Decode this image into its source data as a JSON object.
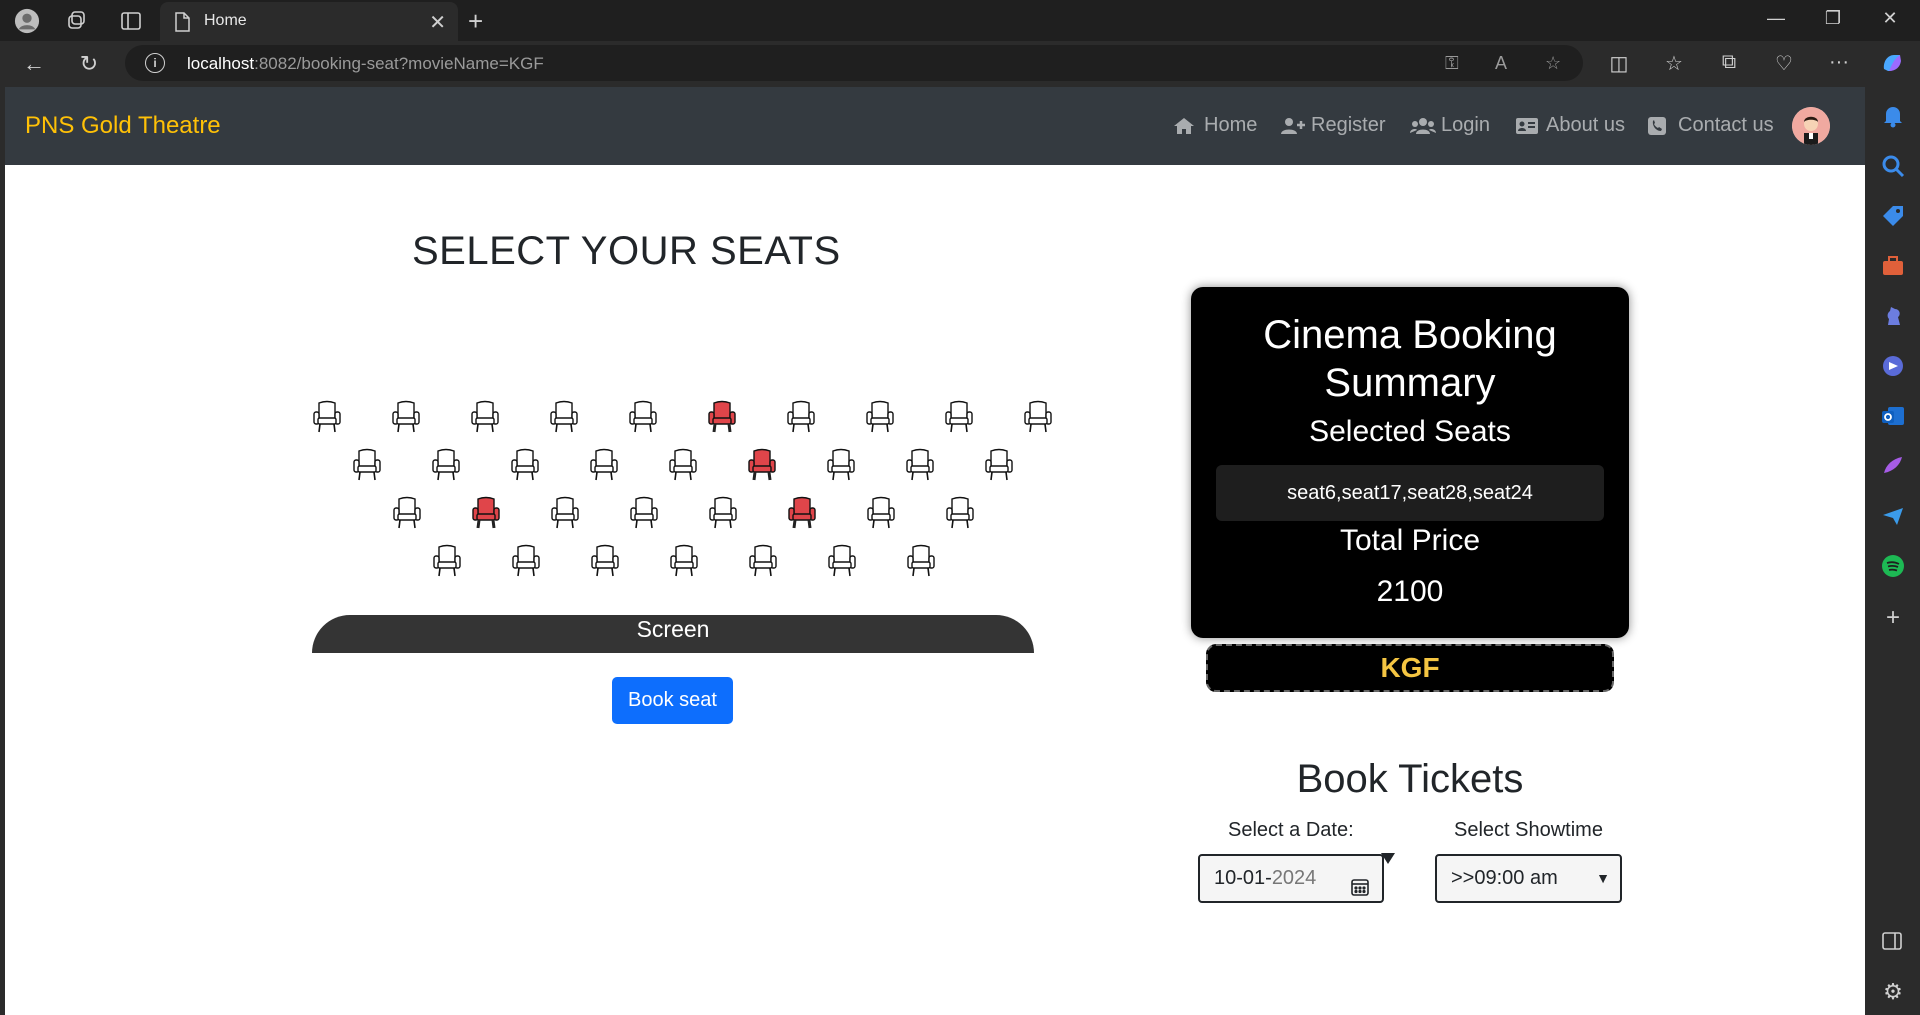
{
  "browser": {
    "tab_title": "Home",
    "url_host": "localhost",
    "url_rest": ":8082/booking-seat?movieName=KGF"
  },
  "navbar": {
    "brand": "PNS Gold Theatre",
    "brand_color": "#ffc107",
    "items": [
      {
        "label": "Home",
        "icon": "home-icon"
      },
      {
        "label": "Register",
        "icon": "user-plus-icon"
      },
      {
        "label": "Login",
        "icon": "users-icon"
      },
      {
        "label": "About us",
        "icon": "id-card-icon"
      },
      {
        "label": "Contact us",
        "icon": "phone-icon"
      }
    ]
  },
  "seating": {
    "title": "SELECT YOUR SEATS",
    "rows": [
      {
        "seats": [
          "available",
          "available",
          "available",
          "available",
          "available",
          "selected",
          "available",
          "available",
          "available",
          "available"
        ]
      },
      {
        "seats": [
          "available",
          "available",
          "available",
          "available",
          "available",
          "selected",
          "available",
          "available",
          "available"
        ]
      },
      {
        "seats": [
          "available",
          "selected",
          "available",
          "available",
          "available",
          "selected",
          "available",
          "available"
        ]
      },
      {
        "seats": [
          "available",
          "available",
          "available",
          "available",
          "available",
          "available",
          "available"
        ]
      }
    ],
    "screen_label": "Screen",
    "book_button": "Book seat",
    "selected_color": "#e0454a"
  },
  "summary": {
    "title": "Cinema Booking Summary",
    "selected_label": "Selected Seats",
    "selected_seats": "seat6,seat17,seat28,seat24",
    "total_label": "Total Price",
    "total_price": "2100"
  },
  "movie_name": "KGF",
  "book_tickets": {
    "title": "Book Tickets",
    "date_label": "Select a Date:",
    "date_value_main": "10-01-",
    "date_value_year": "2024",
    "showtime_label": "Select Showtime",
    "showtime_value": ">>09:00 am"
  }
}
